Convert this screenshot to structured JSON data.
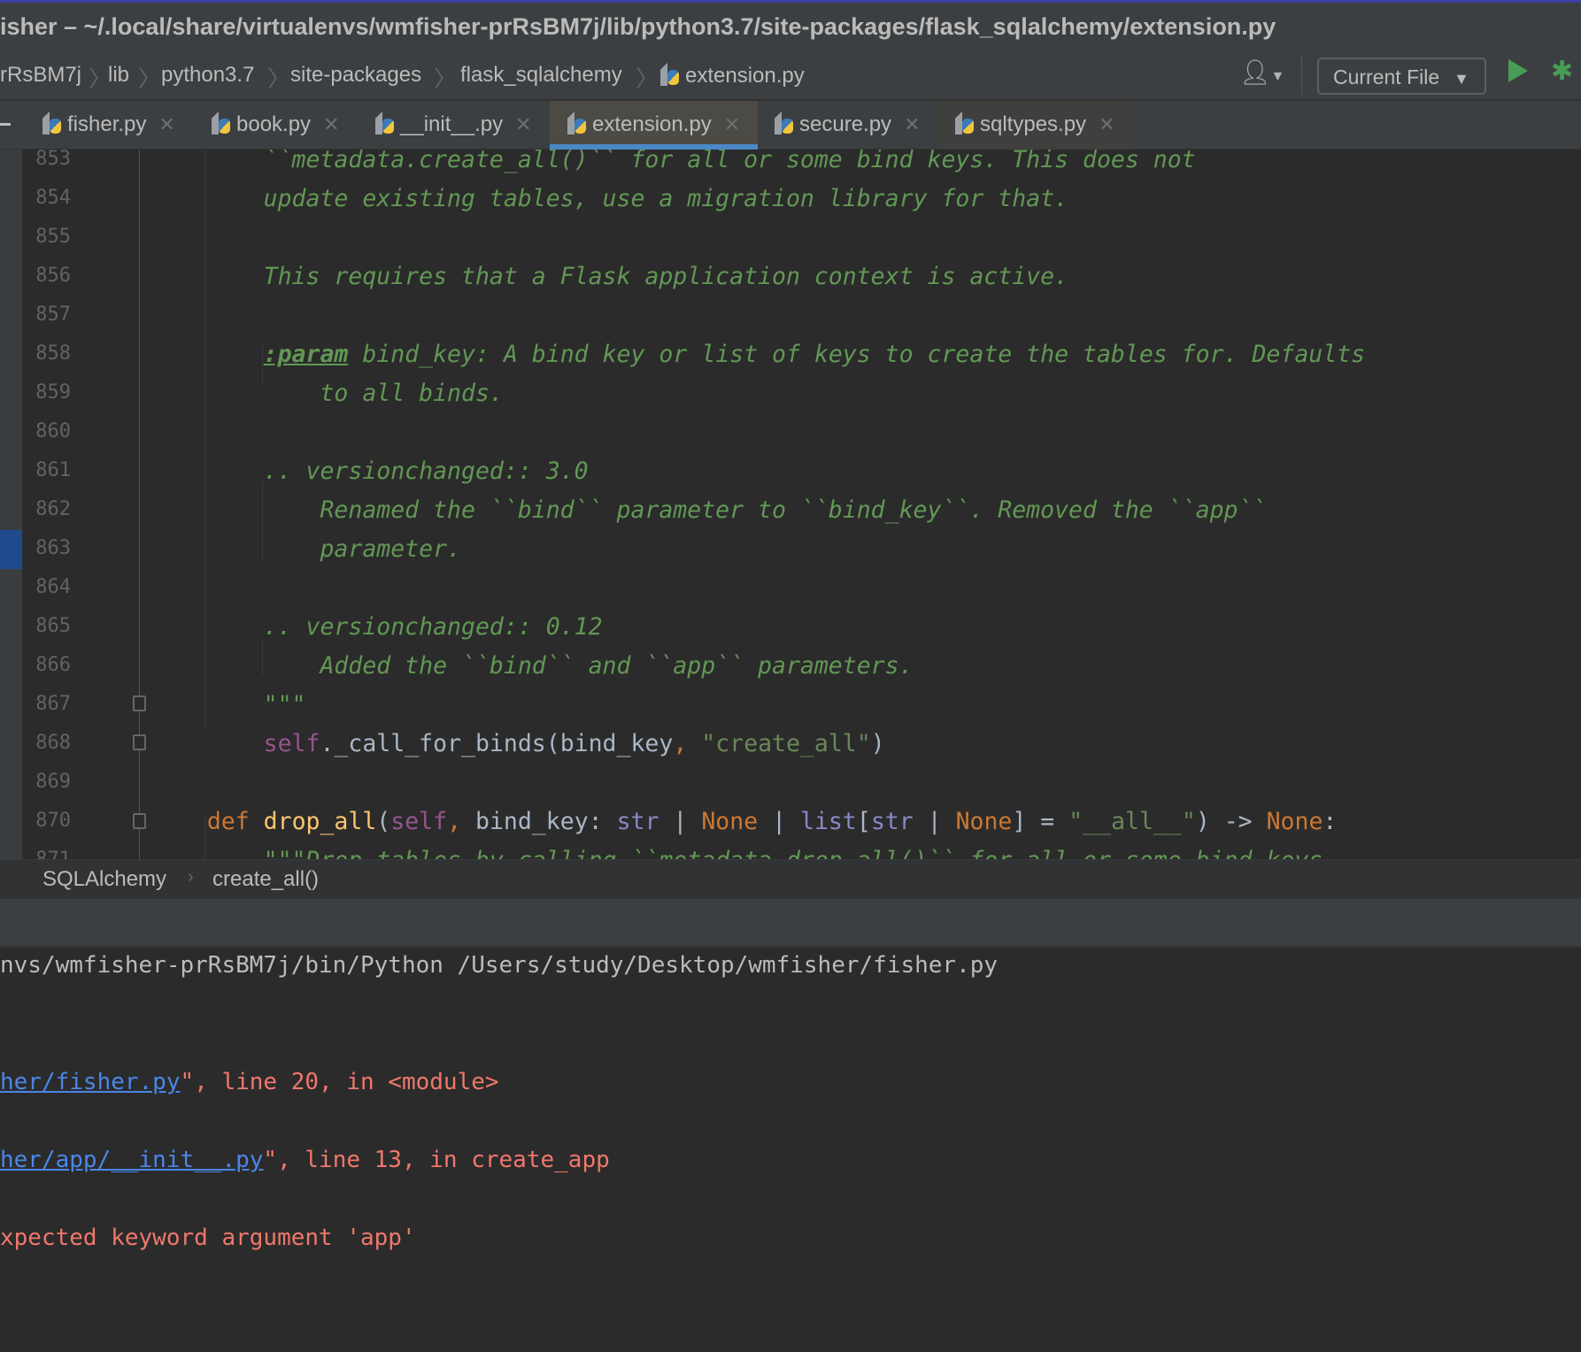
{
  "window": {
    "title": "isher – ~/.local/share/virtualenvs/wmfisher-prRsBM7j/lib/python3.7/site-packages/flask_sqlalchemy/extension.py"
  },
  "navbar": {
    "crumbs": [
      "rRsBM7j",
      "lib",
      "python3.7",
      "site-packages",
      "flask_sqlalchemy",
      "extension.py"
    ],
    "run_config": "Current File",
    "icons": [
      "user-icon",
      "run-icon",
      "debug-icon"
    ]
  },
  "tabs": [
    {
      "label": "fisher.py"
    },
    {
      "label": "book.py"
    },
    {
      "label": "__init__.py"
    },
    {
      "label": "extension.py",
      "active": true
    },
    {
      "label": "secure.py"
    },
    {
      "label": "sqltypes.py"
    }
  ],
  "editor": {
    "selected_line": 863,
    "lines": [
      {
        "n": "853",
        "t": [
          [
            "doc",
            "        ``metadata.create_all()`` for all or some bind keys. This does not"
          ]
        ]
      },
      {
        "n": "854",
        "t": [
          [
            "doc",
            "        update existing tables, use a migration library for that."
          ]
        ]
      },
      {
        "n": "855",
        "t": []
      },
      {
        "n": "856",
        "t": [
          [
            "doc",
            "        This requires that a Flask application context is active."
          ]
        ]
      },
      {
        "n": "857",
        "t": []
      },
      {
        "n": "858",
        "t": [
          [
            "pl",
            "        "
          ],
          [
            "doctag",
            ":param"
          ],
          [
            "doc",
            " bind_key: A bind key or list of keys to create the tables for. Defaults"
          ]
        ]
      },
      {
        "n": "859",
        "t": [
          [
            "doc",
            "            to all binds."
          ]
        ]
      },
      {
        "n": "860",
        "t": []
      },
      {
        "n": "861",
        "t": [
          [
            "doc",
            "        .. versionchanged:: 3.0"
          ]
        ]
      },
      {
        "n": "862",
        "t": [
          [
            "doc",
            "            Renamed the ``bind`` parameter to ``bind_key``. Removed the ``app``"
          ]
        ]
      },
      {
        "n": "863",
        "t": [
          [
            "doc",
            "            parameter."
          ]
        ]
      },
      {
        "n": "864",
        "t": []
      },
      {
        "n": "865",
        "t": [
          [
            "doc",
            "        .. versionchanged:: 0.12"
          ]
        ]
      },
      {
        "n": "866",
        "t": [
          [
            "doc",
            "            Added the ``bind`` and ``app`` parameters."
          ]
        ]
      },
      {
        "n": "867",
        "t": [
          [
            "doc",
            "        \"\"\""
          ]
        ]
      },
      {
        "n": "868",
        "t": [
          [
            "pl",
            "        "
          ],
          [
            "self",
            "self"
          ],
          [
            "pl",
            "._call_for_binds(bind_key"
          ],
          [
            "kw",
            ", "
          ],
          [
            "str",
            "\"create_all\""
          ],
          [
            "pl",
            ")"
          ]
        ]
      },
      {
        "n": "869",
        "t": []
      },
      {
        "n": "870",
        "t": [
          [
            "pl",
            "    "
          ],
          [
            "kw",
            "def "
          ],
          [
            "fn",
            "drop_all"
          ],
          [
            "pl",
            "("
          ],
          [
            "self",
            "self"
          ],
          [
            "kw",
            ", "
          ],
          [
            "pl",
            "bind_key: "
          ],
          [
            "bi",
            "str"
          ],
          [
            "pl",
            " | "
          ],
          [
            "kw",
            "None"
          ],
          [
            "pl",
            " | "
          ],
          [
            "bi",
            "list"
          ],
          [
            "pl",
            "["
          ],
          [
            "bi",
            "str"
          ],
          [
            "pl",
            " | "
          ],
          [
            "kw",
            "None"
          ],
          [
            "pl",
            "] = "
          ],
          [
            "str",
            "\"__all__\""
          ],
          [
            "pl",
            ") -> "
          ],
          [
            "kw",
            "None"
          ],
          [
            "pl",
            ":"
          ]
        ]
      },
      {
        "n": "871",
        "t": [
          [
            "doc",
            "        \"\"\"Drop tables by calling ``metadata.drop_all()`` for all or some bind keys."
          ]
        ]
      }
    ]
  },
  "breadcrumb": {
    "items": [
      "SQLAlchemy",
      "create_all()"
    ]
  },
  "console": {
    "lines": [
      [
        [
          "pl2",
          "nvs/wmfisher-prRsBM7j/bin/Python /Users/study/Desktop/wmfisher/fisher.py"
        ]
      ],
      [
        [
          "link",
          "her/fisher.py"
        ],
        [
          "err",
          "\", line 20, in <module>"
        ]
      ],
      [
        [
          "link",
          "her/app/__init__.py"
        ],
        [
          "err",
          "\", line 13, in create_app"
        ]
      ],
      [
        [
          "err",
          "xpected keyword argument 'app'"
        ]
      ]
    ]
  },
  "colors": {
    "accent": "#4a88c7",
    "run": "#499c54",
    "docstring": "#629755",
    "error": "#f0776c",
    "link": "#4a86e8"
  }
}
